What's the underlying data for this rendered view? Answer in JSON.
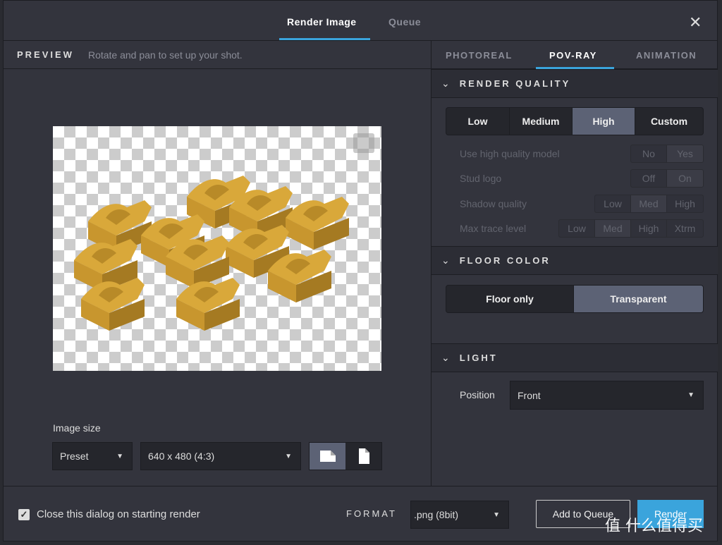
{
  "header": {
    "tabs": [
      {
        "label": "Render Image",
        "active": true
      },
      {
        "label": "Queue",
        "active": false
      }
    ],
    "close_icon": "close-icon"
  },
  "preview": {
    "title": "PREVIEW",
    "hint": "Rotate and pan to set up your shot.",
    "background": "transparent-checkerboard"
  },
  "image_size": {
    "label": "Image size",
    "mode": "Preset",
    "size": "640 x 480 (4:3)",
    "orientation": [
      "landscape",
      "portrait"
    ],
    "selected_orientation": "landscape"
  },
  "right_tabs": [
    {
      "label": "PHOTOREAL"
    },
    {
      "label": "POV-RAY",
      "active": true
    },
    {
      "label": "ANIMATION"
    }
  ],
  "render_quality": {
    "title": "RENDER QUALITY",
    "options": [
      "Low",
      "Medium",
      "High",
      "Custom"
    ],
    "selected": "High",
    "settings": [
      {
        "label": "Use high quality model",
        "options": [
          "No",
          "Yes"
        ],
        "selected": "Yes"
      },
      {
        "label": "Stud logo",
        "options": [
          "Off",
          "On"
        ],
        "selected": "On"
      },
      {
        "label": "Shadow quality",
        "options": [
          "Low",
          "Med",
          "High"
        ],
        "selected": "Med"
      },
      {
        "label": "Max trace level",
        "options": [
          "Low",
          "Med",
          "High",
          "Xtrm"
        ],
        "selected": "Med"
      }
    ]
  },
  "floor_color": {
    "title": "FLOOR COLOR",
    "options": [
      "Floor only",
      "Transparent"
    ],
    "selected": "Transparent"
  },
  "light": {
    "title": "LIGHT",
    "position_label": "Position",
    "position": "Front"
  },
  "footer": {
    "close_on_render": "Close this dialog on starting render",
    "checked": true,
    "format_label": "FORMAT",
    "format": ".png (8bit)",
    "add_to_queue": "Add to Queue",
    "render": "Render"
  },
  "colors": {
    "accent": "#3aa4dc",
    "selected": "#5c6275",
    "brick": "#d4a033"
  },
  "watermark": "值 什么值得买"
}
